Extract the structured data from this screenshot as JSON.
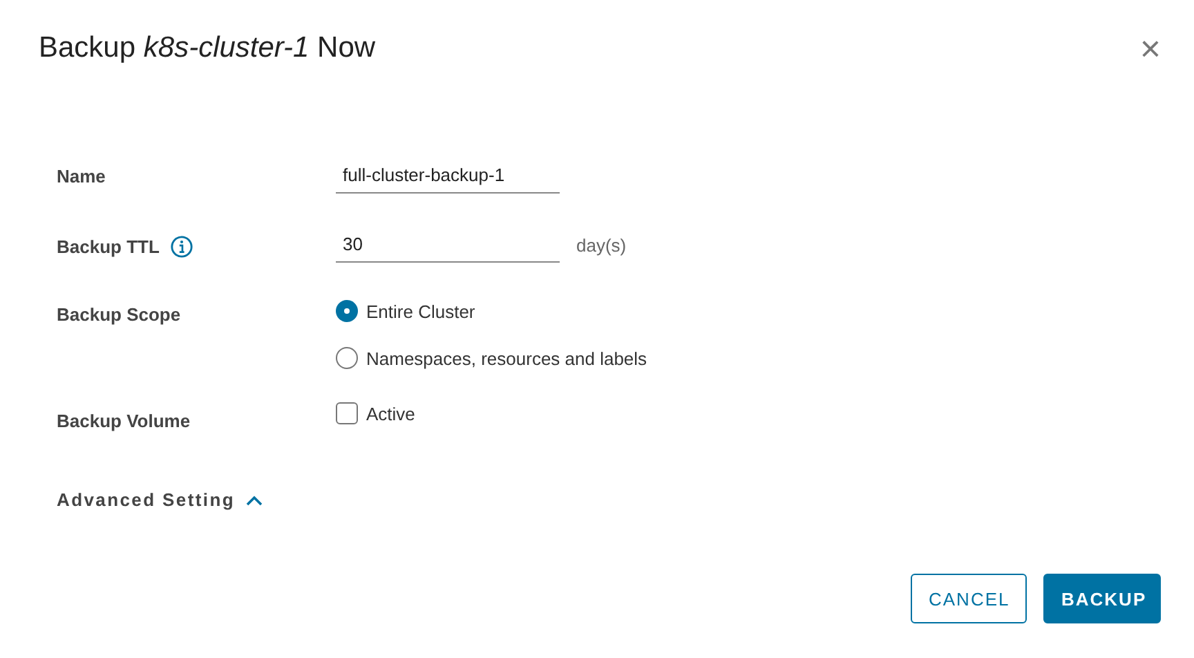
{
  "dialog": {
    "title": "Backup *k8s-cluster-1* Now",
    "close": "×"
  },
  "fields": [
    {
      "kind": "text",
      "label": "Name",
      "value": "full-cluster-backup-1"
    },
    {
      "kind": "text",
      "label": "Backup TTL",
      "info": true,
      "value": "30",
      "suffix": "day(s)"
    },
    {
      "kind": "radio",
      "label": "Backup Scope",
      "options": [
        {
          "label": "Entire Cluster",
          "selected": true
        },
        {
          "label": "Namespaces, resources and labels",
          "selected": false
        }
      ]
    },
    {
      "kind": "checkbox",
      "label": "Backup Volume",
      "option": "Active",
      "checked": false
    }
  ],
  "advanced": {
    "label": "Advanced Setting",
    "expanded": true
  },
  "buttons": [
    {
      "label": "CANCEL",
      "kind": "outline"
    },
    {
      "label": "BACKUP",
      "kind": "primary"
    }
  ]
}
